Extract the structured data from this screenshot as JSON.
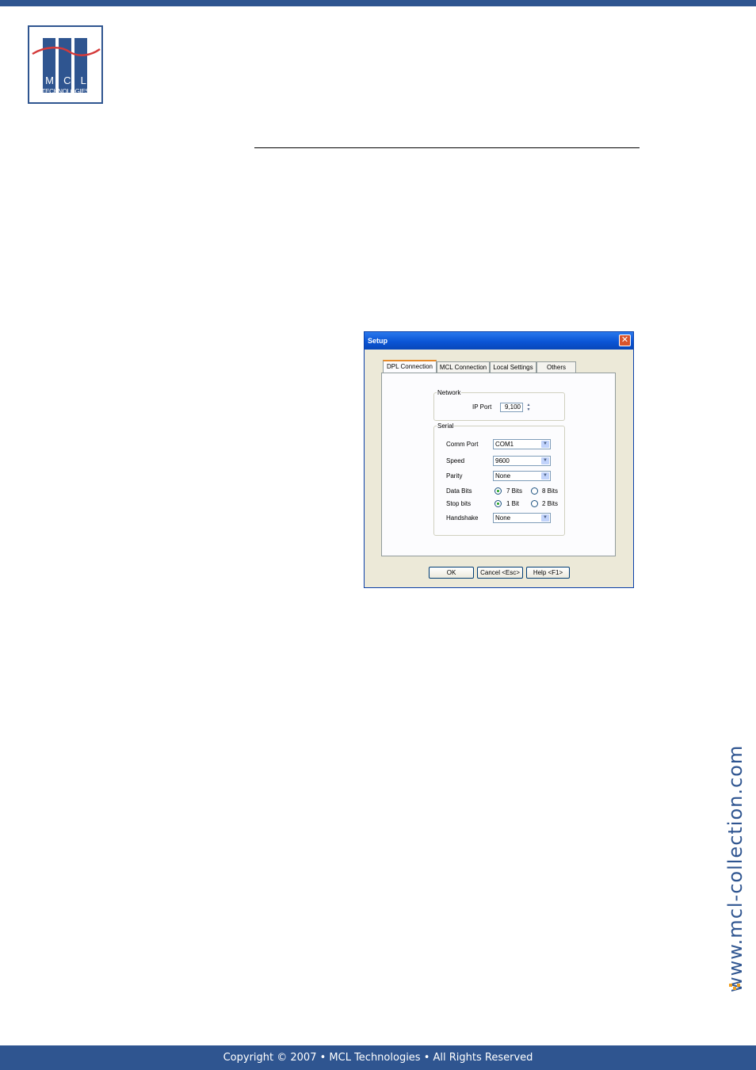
{
  "logo": {
    "letters": [
      "M",
      "C",
      "L"
    ],
    "subtitle": "TECHNOLOGIES"
  },
  "dialog": {
    "title": "Setup",
    "tabs": [
      "DPL Connection",
      "MCL Connection",
      "Local Settings",
      "Others"
    ],
    "active_tab": "DPL Connection",
    "network": {
      "legend": "Network",
      "ip_port_label": "IP Port",
      "ip_port_value": "9,100"
    },
    "serial": {
      "legend": "Serial",
      "comm_port_label": "Comm Port",
      "comm_port_value": "COM1",
      "speed_label": "Speed",
      "speed_value": "9600",
      "parity_label": "Parity",
      "parity_value": "None",
      "data_bits_label": "Data Bits",
      "data_bits_options": [
        "7 Bits",
        "8 Bits"
      ],
      "data_bits_selected": "7 Bits",
      "stop_bits_label": "Stop bits",
      "stop_bits_options": [
        "1 Bit",
        "2 Bits"
      ],
      "stop_bits_selected": "1 Bit",
      "handshake_label": "Handshake",
      "handshake_value": "None"
    },
    "buttons": {
      "ok": "OK",
      "cancel": "Cancel <Esc>",
      "help": "Help <F1>"
    }
  },
  "side_url": "www.mcl-collection.com",
  "footer": "Copyright © 2007 • MCL Technologies • All Rights Reserved",
  "colors": {
    "brand": "#2f5590",
    "logo_wave": "#d43a3a",
    "side_mark": "#f0a020",
    "xp_title": "#0a55d6",
    "tab_highlight": "#e68b2c"
  },
  "icons": {
    "close": "close-icon",
    "dropdown": "chevron-down-icon",
    "spinner": "spinner-icon"
  }
}
